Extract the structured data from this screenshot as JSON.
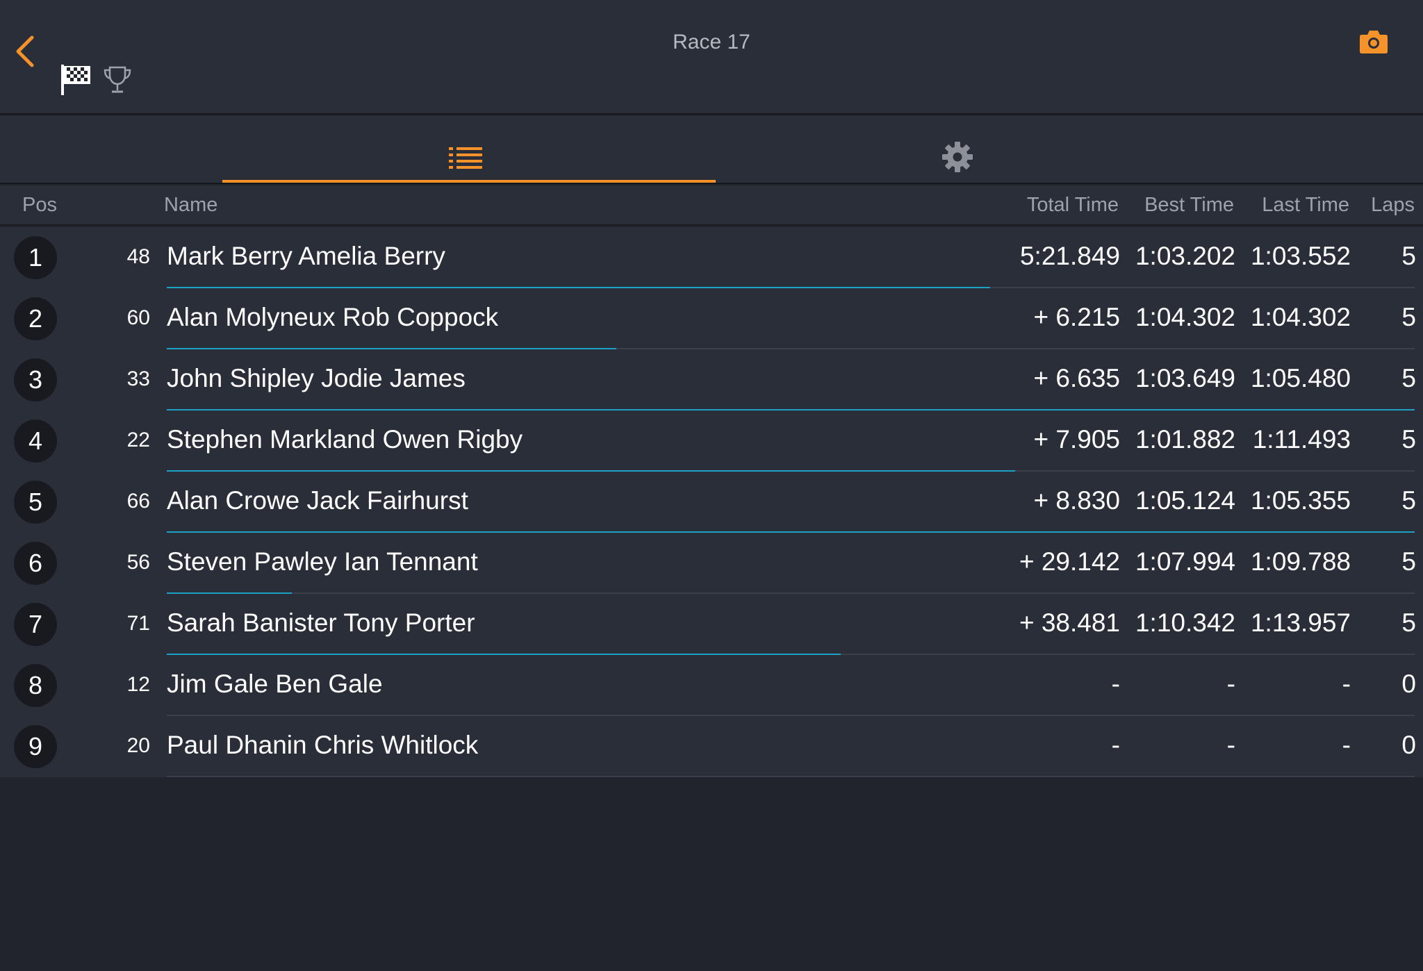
{
  "header": {
    "title": "Race 17",
    "back_icon": "chevron-left-icon",
    "icons": [
      "checkered-flag-icon",
      "trophy-icon",
      "camera-icon"
    ],
    "accent_color": "#f5922a"
  },
  "tabs": [
    {
      "icon": "list-icon",
      "active": true
    },
    {
      "icon": "gear-icon",
      "active": false
    }
  ],
  "table": {
    "columns": {
      "pos": "Pos",
      "name": "Name",
      "total": "Total Time",
      "best": "Best Time",
      "last": "Last Time",
      "laps": "Laps"
    },
    "rows": [
      {
        "pos": "1",
        "kart": "48",
        "name": "Mark Berry Amelia Berry",
        "total": "5:21.849",
        "best": "1:03.202",
        "last": "1:03.552",
        "laps": "5",
        "progress": 0.66
      },
      {
        "pos": "2",
        "kart": "60",
        "name": "Alan Molyneux Rob Coppock",
        "total": "+ 6.215",
        "best": "1:04.302",
        "last": "1:04.302",
        "laps": "5",
        "progress": 0.36
      },
      {
        "pos": "3",
        "kart": "33",
        "name": "John Shipley Jodie James",
        "total": "+ 6.635",
        "best": "1:03.649",
        "last": "1:05.480",
        "laps": "5",
        "progress": 1.0
      },
      {
        "pos": "4",
        "kart": "22",
        "name": "Stephen Markland Owen Rigby",
        "total": "+ 7.905",
        "best": "1:01.882",
        "last": "1:11.493",
        "laps": "5",
        "progress": 0.68
      },
      {
        "pos": "5",
        "kart": "66",
        "name": "Alan Crowe Jack Fairhurst",
        "total": "+ 8.830",
        "best": "1:05.124",
        "last": "1:05.355",
        "laps": "5",
        "progress": 1.0
      },
      {
        "pos": "6",
        "kart": "56",
        "name": "Steven Pawley Ian Tennant",
        "total": "+ 29.142",
        "best": "1:07.994",
        "last": "1:09.788",
        "laps": "5",
        "progress": 0.1
      },
      {
        "pos": "7",
        "kart": "71",
        "name": "Sarah Banister Tony Porter",
        "total": "+ 38.481",
        "best": "1:10.342",
        "last": "1:13.957",
        "laps": "5",
        "progress": 0.54
      },
      {
        "pos": "8",
        "kart": "12",
        "name": "Jim Gale Ben Gale",
        "total": "-",
        "best": "-",
        "last": "-",
        "laps": "0",
        "progress": 0
      },
      {
        "pos": "9",
        "kart": "20",
        "name": "Paul Dhanin Chris Whitlock",
        "total": "-",
        "best": "-",
        "last": "-",
        "laps": "0",
        "progress": 0
      }
    ]
  }
}
